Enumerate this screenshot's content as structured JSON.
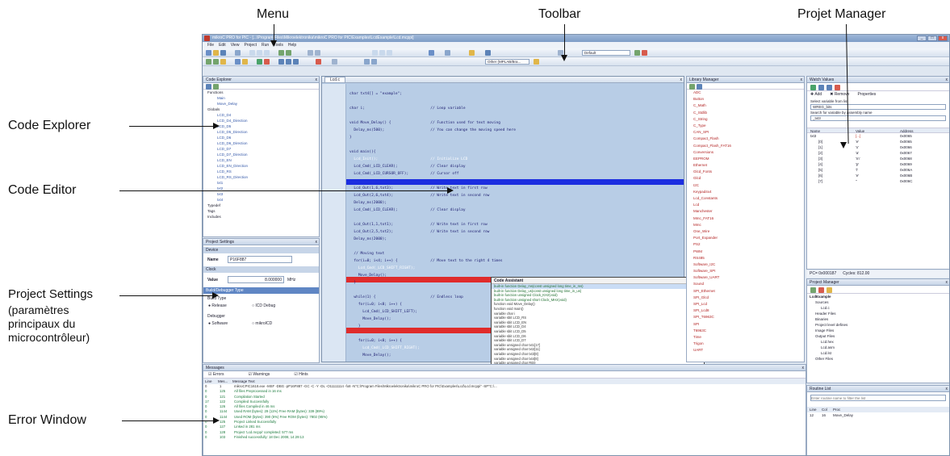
{
  "callouts": {
    "menu": "Menu",
    "toolbar": "Toolbar",
    "project_manager": "Projet Manager",
    "code_explorer": "Code Explorer",
    "code_editor": "Code Editor",
    "project_settings_title": "Project Settings",
    "project_settings_line1": "(paramètres",
    "project_settings_line2": " principaux du",
    "project_settings_line3": "microcontrôleur)",
    "error_window": "Error Window"
  },
  "ide": {
    "title": "mikroC PRO for PIC - [...\\Program Files\\Mikroelektronika\\mikroC PRO for PIC\\Examples\\LcdExample\\Lcd.mcppi]",
    "menu": [
      "File",
      "Edit",
      "View",
      "Project",
      "Run",
      "Tools",
      "Help"
    ],
    "toolbar_config": "Default",
    "toolbar_build": "Other (MPLAB/Bra...",
    "code_explorer": {
      "title": "Code Explorer",
      "items": [
        "Functions",
        "Main",
        "Move_Delay",
        "Globals",
        "LCD_D4",
        "LCD_D4_Direction",
        "LCD_D5",
        "LCD_D5_Direction",
        "LCD_D6",
        "LCD_D6_Direction",
        "LCD_D7",
        "LCD_D7_Direction",
        "LCD_EN",
        "LCD_EN_Direction",
        "LCD_RS",
        "LCD_RS_Direction",
        "txt1",
        "txt2",
        "txt3",
        "txt4",
        "Typedef",
        "Tags",
        "Includes"
      ]
    },
    "project_settings": {
      "title": "Project Settings",
      "device_label": "Device",
      "name_label": "Name",
      "name_value": "P16F887",
      "clock_label": "Clock",
      "value_label": "Value",
      "value_value": "8.000000",
      "value_unit": "MHz",
      "build_debug_title": "Build/Debugger Type",
      "build_type_label": "Build Type",
      "release": "Release",
      "icd_debug": "ICD Debug",
      "debugger_label": "Debugger",
      "software": "Software",
      "mikroicd": "mikroICD"
    },
    "editor": {
      "tab": "Lcd.c",
      "lines": [
        "char txt4[] = \"example\";",
        "",
        "char i;                              // Loop variable",
        "",
        "void Move_Delay() {                  // Function used for text moving",
        "  Delay_ms(500);                     // You can change the moving speed here",
        "}",
        "",
        "void main(){",
        "  Lcd_Init();                        // Initialize LCD",
        "  Lcd_Cmd(_LCD_CLEAR);               // Clear display",
        "  Lcd_Cmd(_LCD_CURSOR_OFF);          // Cursor off",
        "",
        "  Lcd_Out(1,6,txt3);                 // Write text in first row",
        "  Lcd_Out(2,6,txt4);                 // Write text in second row",
        "  Delay_ms(2000);",
        "  Lcd_Cmd(_LCD_CLEAR);               // Clear display",
        "",
        "  Lcd_Out(1,1,txt1);                 // Write text in first row",
        "  Lcd_Out(2,5,txt2);                 // Write text in second row",
        "  Delay_ms(2000);",
        "",
        "  // Moving text",
        "  for(i=0; i<4; i++) {               // Move text to the right 4 times",
        "    Lcd_Cmd(_LCD_SHIFT_RIGHT);",
        "    Move_Delay();",
        "  }",
        "",
        "  while(1) {                         // Endless loop",
        "    for(i=0; i<8; i++) {",
        "      Lcd_Cmd(_LCD_SHIFT_LEFT);",
        "      Move_Delay();",
        "    }",
        "",
        "    for(i=0; i<8; i++) {",
        "      Lcd_Cmd(_LCD_SHIFT_RIGHT);",
        "      Move_Delay();",
        "    }",
        "  }",
        "}"
      ]
    },
    "code_assistant": {
      "title": "Code Assistant",
      "rows": [
        "built-in function   Delay_ms(const unsigned long time_in_ms)",
        "built-in function   Delay_us(const unsigned long time_in_us)",
        "built-in function   unsigned Clock_KHz(void)",
        "built-in function   unsigned short Clock_MHz(void)",
        "function   void Move_Delay()",
        "function   void main()",
        "variable   char i",
        "variable   sbit LCD_RS",
        "variable   sbit LCD_EN",
        "variable   sbit LCD_D4",
        "variable   sbit LCD_D5",
        "variable   sbit LCD_D6",
        "variable   sbit LCD_D7",
        "variable   unsigned char txt1[17]",
        "variable   unsigned char txt2[11]",
        "variable   unsigned char txt3[8]",
        "variable   unsigned char txt4[8]",
        "variable   unsigned char RE0",
        "variable   unsigned char RE1",
        "variable   unsigned char RE2",
        "variable   unsigned char RE3",
        "variable   unsigned char RE4",
        "variable   unsigned char RE5",
        "variable   unsigned char RE6",
        "variable   unsigned char RE7"
      ]
    },
    "library_manager": {
      "title": "Library Manager",
      "items": [
        "ADC",
        "Button",
        "C_Math",
        "C_Stdlib",
        "C_String",
        "C_Type",
        "CAN_SPI",
        "Compact_Flash",
        "Compact_Flash_FAT16",
        "Conversions",
        "EEPROM",
        "Ethernet",
        "Glcd_Fonts",
        "Glcd",
        "I2C",
        "Keypad4x4",
        "Lcd_Constants",
        "Lcd",
        "Manchester",
        "Mmc_FAT16",
        "Mmc",
        "One_Wire",
        "Port_Expander",
        "PS2",
        "PWM",
        "RS485",
        "Software_I2C",
        "Software_SPI",
        "Software_UART",
        "Sound",
        "SPI_Ethernet",
        "SPI_Glcd",
        "SPI_Lcd",
        "SPI_Lcd8",
        "SPI_T6963C",
        "SPI",
        "T6963C",
        "Time",
        "Trigon",
        "UART"
      ]
    },
    "watch_values": {
      "title": "Watch Values",
      "add": "Add",
      "remove": "Remove",
      "properties": "Properties",
      "select_label": "Select variable from list",
      "select_value": "WREG_bits",
      "search_label": "Search for variable by assembly name",
      "search_value": "_txt3",
      "columns": [
        "Name",
        "Value",
        "Address"
      ],
      "rows": [
        [
          "txt3",
          "[...]",
          "0x0065"
        ],
        [
          "[0]",
          "'e'",
          "0x0065"
        ],
        [
          "[1]",
          "'x'",
          "0x0066"
        ],
        [
          "[2]",
          "'a'",
          "0x0067"
        ],
        [
          "[3]",
          "'m'",
          "0x0068"
        ],
        [
          "[4]",
          "'p'",
          "0x0069"
        ],
        [
          "[5]",
          "'l'",
          "0x006A"
        ],
        [
          "[6]",
          "'e'",
          "0x006B"
        ],
        [
          "[7]",
          "''",
          "0x006C"
        ]
      ],
      "pc": "PC= 0x000187",
      "cycles": "Cycles: 812.00"
    },
    "project_manager": {
      "title": "Project Manager",
      "items": [
        "LcdExample",
        "Sources",
        "Lcd.c",
        "Header Files",
        "Binaries",
        "Project level defines",
        "Image Files",
        "Output Files",
        "Lcd.hex",
        "Lcd.asm",
        "Lcd.lst",
        "Other Files"
      ]
    },
    "routine_list": {
      "title": "Routine List",
      "filter_placeholder": "Enter routine name to filter the list",
      "columns": [
        "Line",
        "Col",
        "Proc"
      ],
      "rows": [
        [
          "12",
          "16",
          "Move_Delay"
        ]
      ]
    },
    "messages": {
      "title": "Messages",
      "filters": [
        "Errors",
        "Warnings",
        "Hints"
      ],
      "columns": [
        "Line",
        "Mes...",
        "Message Text"
      ],
      "rows": [
        [
          "0",
          "1",
          "mikroCPIC1618.exe -MSF -DBG -pP16F887 -GC -C -Y -DL -O11111114 -fo8 -N\"C:\\Program Files\\Mikroelektronika\\mikroC PRO for PIC\\Examples\\Lcd\\Lcd.mcppi\" -SP\"C:\\..."
        ],
        [
          "0",
          "125",
          "All files Preprocessed in 16 ms"
        ],
        [
          "0",
          "121",
          "Compilation Started"
        ],
        [
          "17",
          "122",
          "Compiled Successfully"
        ],
        [
          "0",
          "126",
          "All files Compiled in 46 ms"
        ],
        [
          "0",
          "1144",
          "Used RAM (bytes): 29 (11%)  Free RAM (bytes): 339 (89%)"
        ],
        [
          "0",
          "1144",
          "Used ROM (bytes): 390 (5%)  Free ROM (bytes): 7802 (95%)"
        ],
        [
          "0",
          "125",
          "Project Linked Successfully"
        ],
        [
          "0",
          "127",
          "Linked in 281 ms"
        ],
        [
          "0",
          "128",
          "Project 'Lcd.mcppi' completed: 577 ms"
        ],
        [
          "0",
          "103",
          "Finished successfully: 18 Dec 2008, 14:29:13"
        ]
      ]
    }
  }
}
